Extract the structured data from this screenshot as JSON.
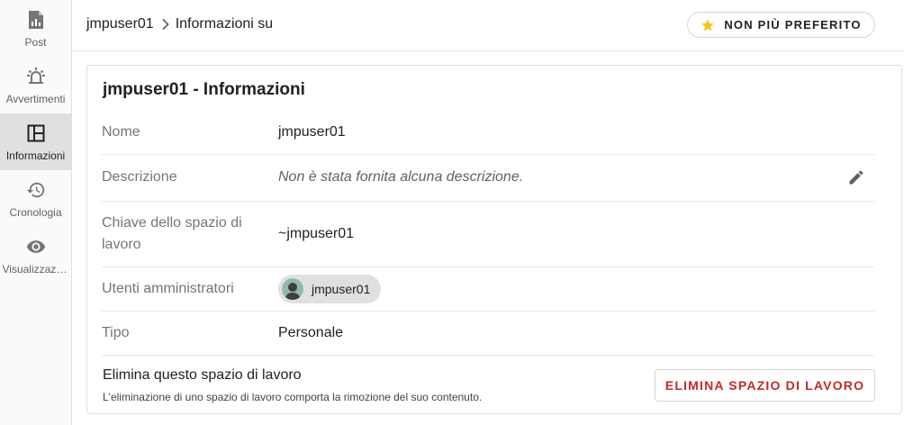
{
  "sidebar": {
    "items": [
      {
        "label": "Post",
        "icon": "post-icon"
      },
      {
        "label": "Avvertimenti",
        "icon": "alert-icon"
      },
      {
        "label": "Informazioni",
        "icon": "info-layout-icon",
        "active": true
      },
      {
        "label": "Cronologia",
        "icon": "history-icon"
      },
      {
        "label": "Visualizzazioni",
        "icon": "eye-icon"
      }
    ]
  },
  "header": {
    "breadcrumb": {
      "workspace": "jmpuser01",
      "page": "Informazioni su"
    },
    "favorite_label": "NON PIÙ PREFERITO"
  },
  "card": {
    "title": "jmpuser01 - Informazioni",
    "name": {
      "key": "Nome",
      "value": "jmpuser01"
    },
    "description": {
      "key": "Descrizione",
      "value": "Non è stata fornita alcuna descrizione."
    },
    "workspace_key": {
      "key_line1": "Chiave dello spazio di",
      "key_line2": "lavoro",
      "value": "~jmpuser01"
    },
    "admins": {
      "key": "Utenti amministratori",
      "users": [
        "jmpuser01"
      ]
    },
    "type": {
      "key": "Tipo",
      "value": "Personale"
    },
    "danger": {
      "title": "Elimina questo spazio di lavoro",
      "description": "L'eliminazione di uno spazio di lavoro comporta la rimozione del suo contenuto.",
      "button": "ELIMINA SPAZIO DI LAVORO"
    }
  },
  "colors": {
    "accent_star": "#f9c513",
    "danger": "#c62828",
    "active_nav": "#e0e0e0"
  }
}
